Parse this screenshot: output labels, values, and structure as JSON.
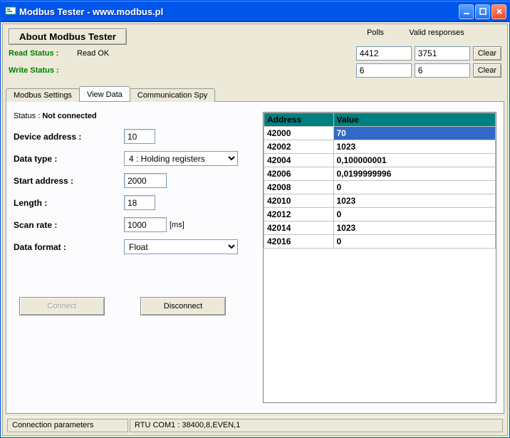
{
  "window": {
    "title": "Modbus Tester - www.modbus.pl"
  },
  "about_button": "About Modbus Tester",
  "columns": {
    "polls": "Polls",
    "valid": "Valid responses"
  },
  "read_status": {
    "label": "Read Status",
    "value": "Read OK"
  },
  "write_status": {
    "label": "Write Status",
    "value": ""
  },
  "counters": {
    "read_polls": "4412",
    "read_valid": "3751",
    "write_polls": "6",
    "write_valid": "6"
  },
  "clear_label": "Clear",
  "tabs": {
    "settings": "Modbus Settings",
    "view": "View Data",
    "spy": "Communication Spy"
  },
  "conn": {
    "status_label": "Status :",
    "status_value": "Not connected"
  },
  "form": {
    "device_address_label": "Device address",
    "device_address": "10",
    "data_type_label": "Data type",
    "data_type": "4 : Holding registers",
    "start_address_label": "Start address",
    "start_address": "2000",
    "length_label": "Length",
    "length": "18",
    "scan_rate_label": "Scan rate",
    "scan_rate": "1000",
    "scan_rate_unit": "[ms]",
    "data_format_label": "Data format",
    "data_format": "Float"
  },
  "buttons": {
    "connect": "Connect",
    "disconnect": "Disconnect"
  },
  "grid_headers": {
    "address": "Address",
    "value": "Value"
  },
  "rows": [
    {
      "addr": "42000",
      "val": "70"
    },
    {
      "addr": "42002",
      "val": "1023"
    },
    {
      "addr": "42004",
      "val": "0,100000001"
    },
    {
      "addr": "42006",
      "val": "0,0199999996"
    },
    {
      "addr": "42008",
      "val": "0"
    },
    {
      "addr": "42010",
      "val": "1023"
    },
    {
      "addr": "42012",
      "val": "0"
    },
    {
      "addr": "42014",
      "val": "1023"
    },
    {
      "addr": "42016",
      "val": "0"
    }
  ],
  "statusbar": {
    "label": "Connection parameters",
    "value": "RTU  COM1 : 38400,8,EVEN,1"
  }
}
